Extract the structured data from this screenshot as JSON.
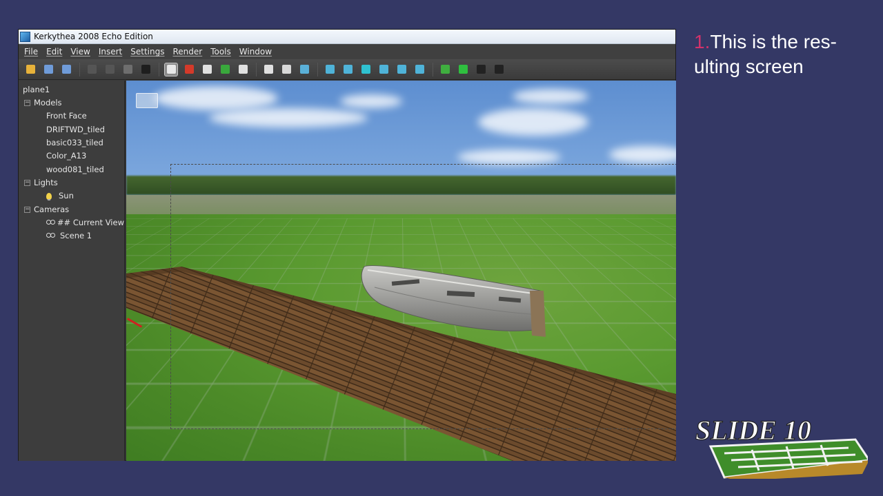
{
  "window": {
    "title": "Kerkythea 2008 Echo Edition"
  },
  "menu": [
    "File",
    "Edit",
    "View",
    "Insert",
    "Settings",
    "Render",
    "Tools",
    "Window"
  ],
  "toolbar": {
    "groups": [
      [
        {
          "icon": "open-folder-icon",
          "color": "#e7b23a"
        },
        {
          "icon": "save-icon",
          "color": "#6f9bd8"
        },
        {
          "icon": "save-as-icon",
          "color": "#6f9bd8"
        }
      ],
      [
        {
          "icon": "undo-icon",
          "color": "#555555"
        },
        {
          "icon": "redo-icon",
          "color": "#555555"
        },
        {
          "icon": "wand-icon",
          "color": "#6e6e6e"
        },
        {
          "icon": "material-icon",
          "color": "#1e1e1e"
        }
      ],
      [
        {
          "icon": "select-arrow-icon",
          "color": "#e8e8e8",
          "selected": true
        },
        {
          "icon": "target-icon",
          "color": "#d43a2a"
        },
        {
          "icon": "hand-icon",
          "color": "#e0e0e0"
        },
        {
          "icon": "rotate-icon",
          "color": "#39a83c"
        },
        {
          "icon": "zoom-icon",
          "color": "#e0e0e0"
        }
      ],
      [
        {
          "icon": "home-icon",
          "color": "#e0e0e0"
        },
        {
          "icon": "camera-left-icon",
          "color": "#d8d8d8"
        },
        {
          "icon": "camera-link-icon",
          "color": "#5ab0d8"
        }
      ],
      [
        {
          "icon": "view-cube-1-icon",
          "color": "#4fb3d8"
        },
        {
          "icon": "view-cube-2-icon",
          "color": "#4fb3d8"
        },
        {
          "icon": "view-cube-3-icon",
          "color": "#2fc1d0"
        },
        {
          "icon": "view-cube-4-icon",
          "color": "#4fb3d8"
        },
        {
          "icon": "view-cube-5-icon",
          "color": "#4fb3d8"
        },
        {
          "icon": "view-cube-6-icon",
          "color": "#4fb3d8"
        }
      ],
      [
        {
          "icon": "render-image-icon",
          "color": "#3fae3f"
        },
        {
          "icon": "render-start-icon",
          "color": "#2fbf3f"
        },
        {
          "icon": "settings-gear-icon",
          "color": "#222222"
        },
        {
          "icon": "stop-icon",
          "color": "#222222"
        }
      ]
    ]
  },
  "tree": {
    "root": "plane1",
    "sections": [
      {
        "label": "Models",
        "items": [
          "Front Face",
          "DRIFTWD_tiled",
          "basic033_tiled",
          "Color_A13",
          "wood081_tiled"
        ]
      },
      {
        "label": "Lights",
        "items": [
          "Sun"
        ]
      },
      {
        "label": "Cameras",
        "items": [
          "## Current View",
          "Scene 1"
        ]
      }
    ]
  },
  "slide": {
    "step_number": "1.",
    "step_text_line1": "This is the res-",
    "step_text_line2": "ulting screen",
    "badge": "SLIDE 10"
  },
  "colors": {
    "slide_background": "#343865",
    "accent": "#d2326b",
    "app_dark": "#3a3a3a"
  }
}
